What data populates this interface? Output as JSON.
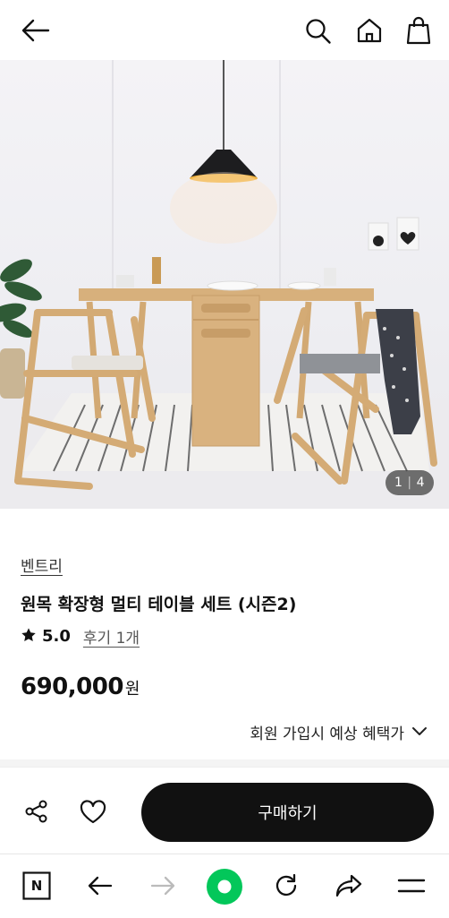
{
  "hero": {
    "counter_current": "1",
    "counter_total": "4"
  },
  "product": {
    "brand": "벤트리",
    "title": "원목 확장형 멀티 테이블 세트 (시즌2)",
    "rating": "5.0",
    "reviews": "후기 1개",
    "price": "690,000",
    "price_unit": "원",
    "benefit": "회원 가입시 예상 혜택가"
  },
  "actions": {
    "buy_label": "구매하기"
  },
  "browser": {
    "home_letter": "N"
  },
  "colors": {
    "accent_green": "#03c75a",
    "buy_button": "#111111"
  },
  "icons": [
    "back-arrow-icon",
    "search-icon",
    "home-icon",
    "shopping-bag-icon",
    "share-icon",
    "heart-icon",
    "naver-n-icon",
    "browser-back-icon",
    "browser-forward-icon",
    "green-dot-icon",
    "refresh-icon",
    "forward-share-icon",
    "menu-icon",
    "chevron-down-icon",
    "star-icon"
  ]
}
